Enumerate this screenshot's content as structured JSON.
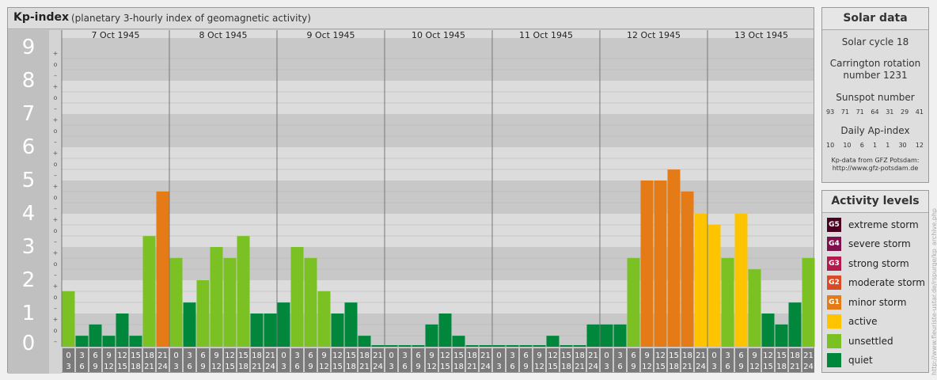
{
  "title": {
    "main": "Kp-index",
    "sub": "(planetary 3-hourly index of geomagnetic activity)"
  },
  "chart_data": {
    "type": "bar",
    "title": "Kp-index",
    "subtitle": "(planetary 3-hourly index of geomagnetic activity)",
    "ylim": [
      0,
      9
    ],
    "y_ticks": [
      "0",
      "1",
      "2",
      "3",
      "4",
      "5",
      "6",
      "7",
      "8",
      "9"
    ],
    "y_sublabels": [
      "–",
      "o",
      "+"
    ],
    "days": [
      "7 Oct 1945",
      "8 Oct 1945",
      "9 Oct 1945",
      "10 Oct 1945",
      "11 Oct 1945",
      "12 Oct 1945",
      "13 Oct 1945"
    ],
    "hour_start": [
      "0",
      "3",
      "6",
      "9",
      "12",
      "15",
      "18",
      "21"
    ],
    "hour_end": [
      "3",
      "6",
      "9",
      "12",
      "15",
      "18",
      "21",
      "24"
    ],
    "values": [
      [
        1.67,
        0.33,
        0.67,
        0.33,
        1.0,
        0.33,
        3.33,
        4.67
      ],
      [
        2.67,
        1.33,
        2.0,
        3.0,
        2.67,
        3.33,
        1.0,
        1.0
      ],
      [
        1.33,
        3.0,
        2.67,
        1.67,
        1.0,
        1.33,
        0.33,
        0
      ],
      [
        0,
        0,
        0,
        0.67,
        1.0,
        0.33,
        0,
        0
      ],
      [
        0,
        0,
        0,
        0,
        0.33,
        0,
        0,
        0.67
      ],
      [
        0.67,
        0.67,
        2.67,
        5.0,
        5.0,
        5.33,
        4.67,
        4.0
      ],
      [
        3.67,
        2.67,
        4.0,
        2.33,
        1.0,
        0.67,
        1.33,
        2.67
      ]
    ],
    "grid": true
  },
  "colors": {
    "quiet": "#00873c",
    "unsettled": "#7cc123",
    "active": "#ffc400",
    "G1": "#e57b17",
    "G2": "#d94a26",
    "G3": "#b31a4d",
    "G4": "#80104d",
    "G5": "#4a0020"
  },
  "solar": {
    "title": "Solar data",
    "cycle": "Solar cycle 18",
    "carrington_1": "Carrington rotation",
    "carrington_2": "number 1231",
    "sunspot_label": "Sunspot number",
    "sunspots": [
      "93",
      "71",
      "71",
      "64",
      "31",
      "29",
      "41"
    ],
    "ap_label": "Daily Ap-index",
    "ap": [
      "10",
      "10",
      "6",
      "1",
      "1",
      "30",
      "12"
    ],
    "source_1": "Kp-data from GFZ Potsdam:",
    "source_2": "http://www.gfz-potsdam.de"
  },
  "levels": {
    "title": "Activity levels",
    "items": [
      {
        "badge": "G5",
        "label": "extreme storm",
        "color": "#4a0020"
      },
      {
        "badge": "G4",
        "label": "severe storm",
        "color": "#80104d"
      },
      {
        "badge": "G3",
        "label": "strong storm",
        "color": "#b31a4d"
      },
      {
        "badge": "G2",
        "label": "moderate storm",
        "color": "#d94a26"
      },
      {
        "badge": "G1",
        "label": "minor storm",
        "color": "#e57b17"
      },
      {
        "badge": "",
        "label": "active",
        "color": "#ffc400"
      },
      {
        "badge": "",
        "label": "unsettled",
        "color": "#7cc123"
      },
      {
        "badge": "",
        "label": "quiet",
        "color": "#00873c"
      }
    ]
  },
  "credit": "http://www.fleuriste-ustar.de/rspurge/kp_archive.php"
}
